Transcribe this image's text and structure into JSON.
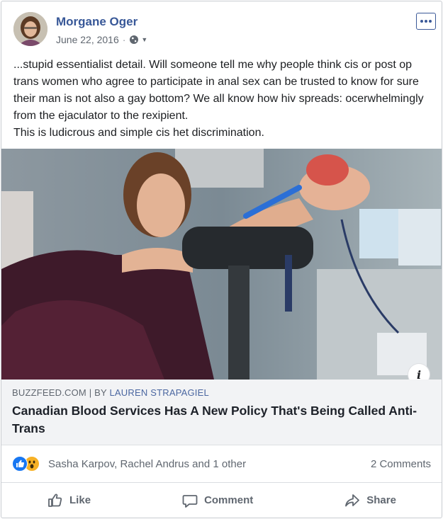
{
  "post": {
    "author": "Morgane Oger",
    "date": "June 22, 2016",
    "date_separator": "·",
    "privacy_icon": "globe-icon",
    "more_icon": "more-options-icon",
    "text": "...stupid essentialist detail. Will someone tell me why people think cis or post op trans women who agree to participate in anal sex can be trusted to know for sure their man is not also a gay bottom? We all know how hiv spreads: ocerwhelmingly from the ejaculator to the rexipient.\nThis is ludicrous and simple cis het discrimination."
  },
  "link": {
    "source": "BUZZFEED.COM",
    "separator": "|",
    "by_prefix": "BY",
    "byline": "LAUREN STRAPAGIEL",
    "headline": "Canadian Blood Services Has A New Policy That's Being Called Anti-Trans",
    "info_label": "i"
  },
  "reactions": {
    "names": "Sasha Karpov, Rachel Andrus and 1 other",
    "comments": "2 Comments",
    "icons": [
      "like-reaction-icon",
      "wow-reaction-icon"
    ]
  },
  "actions": {
    "like": "Like",
    "comment": "Comment",
    "share": "Share"
  },
  "colors": {
    "author": "#385898",
    "accent": "#1877f2",
    "meta": "#606770",
    "link_bg": "#f2f3f5"
  }
}
